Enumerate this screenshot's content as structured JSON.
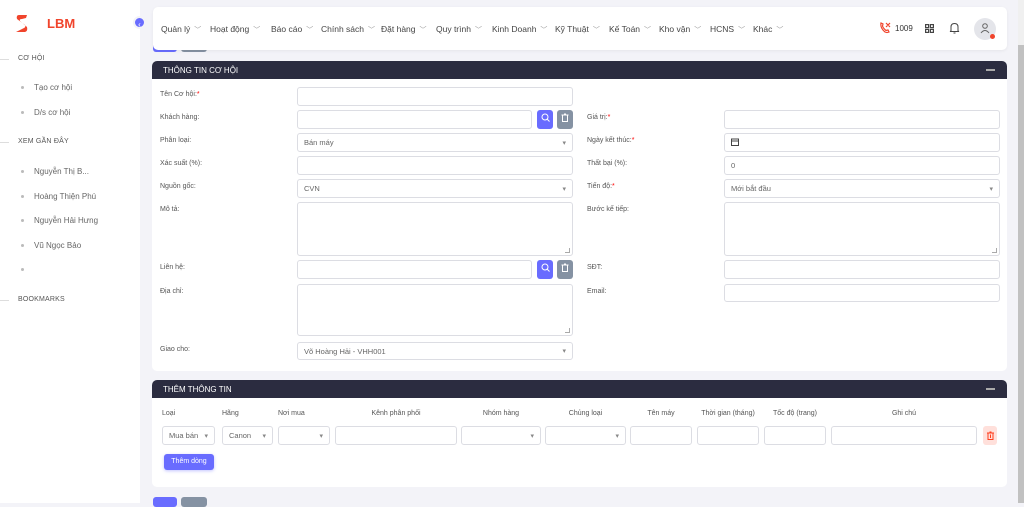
{
  "brand": {
    "name": "LBM",
    "color": "#f0442c",
    "accent": "#696cff"
  },
  "sidebar": {
    "sections": [
      {
        "title": "CƠ HỘI",
        "items": [
          "Tạo cơ hội",
          "D/s cơ hội"
        ]
      },
      {
        "title": "XEM GẦN ĐÂY",
        "items": [
          "Nguyễn Thị B...",
          "Hoàng Thiện Phú",
          "Nguyễn Hải Hưng",
          "Vũ Ngọc Bảo",
          ""
        ]
      },
      {
        "title": "BOOKMARKS",
        "items": []
      }
    ]
  },
  "nav": {
    "menus": [
      "Quản lý",
      "Hoạt động",
      "Báo cáo",
      "Chính sách",
      "Đặt hàng",
      "Quy trình",
      "Kinh Doanh",
      "Kỹ Thuật",
      "Kế Toán",
      "Kho vận",
      "HCNS",
      "Khác"
    ],
    "call_count": "1009"
  },
  "form": {
    "title": "THÔNG TIN CƠ HỘI",
    "left": {
      "ten_co_hoi": {
        "label": "Tên Cơ hội:",
        "value": ""
      },
      "khach_hang": {
        "label": "Khách hàng:",
        "value": ""
      },
      "phan_loai": {
        "label": "Phân loại:",
        "value": "Bán máy"
      },
      "xac_suat": {
        "label": "Xác suất (%):",
        "value": ""
      },
      "nguon_goc": {
        "label": "Nguồn gốc:",
        "value": "CVN"
      },
      "mo_ta": {
        "label": "Mô tả:",
        "value": ""
      },
      "lien_he": {
        "label": "Liên hệ:",
        "value": ""
      },
      "dia_chi": {
        "label": "Địa chỉ:",
        "value": ""
      },
      "giao_cho": {
        "label": "Giao cho:",
        "value": "Võ Hoàng Hải - VHH001"
      }
    },
    "right": {
      "gia_tri": {
        "label": "Giá trị:",
        "value": ""
      },
      "ngay_ket_thuc": {
        "label": "Ngày kết thúc:",
        "value": ""
      },
      "that_bai": {
        "label": "Thất bại (%):",
        "value": "0"
      },
      "tien_do": {
        "label": "Tiến độ:",
        "value": "Mới bắt đầu"
      },
      "buoc_ke_tiep": {
        "label": "Bước kế tiếp:",
        "value": ""
      },
      "sdt": {
        "label": "SĐT:",
        "value": ""
      },
      "email": {
        "label": "Email:",
        "value": ""
      }
    },
    "required_mark": "*"
  },
  "extra": {
    "title": "THÊM THÔNG TIN",
    "columns": [
      "Loại",
      "Hãng",
      "Nơi mua",
      "Kênh phân phối",
      "Nhóm hàng",
      "Chủng loại",
      "Tên máy",
      "Thời gian (tháng)",
      "Tốc độ (trang)",
      "Ghi chú"
    ],
    "row": {
      "loai": "Mua bán",
      "hang": "Canon"
    },
    "add_row_label": "Thêm dòng"
  }
}
